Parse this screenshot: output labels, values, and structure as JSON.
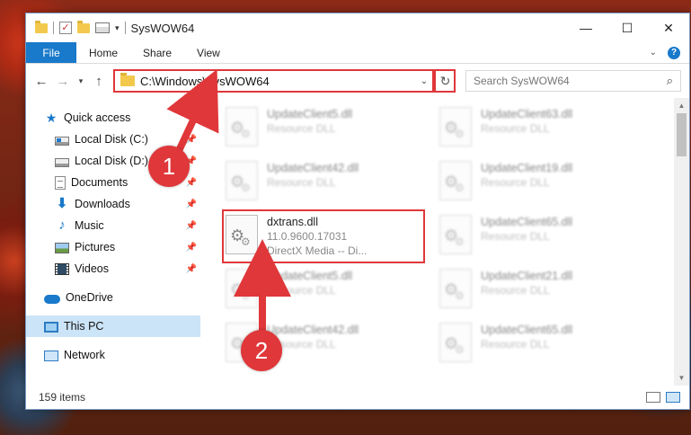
{
  "window": {
    "title": "SysWOW64",
    "minimize_label": "—",
    "maximize_label": "☐",
    "close_label": "✕"
  },
  "ribbon": {
    "tabs": [
      "File",
      "Home",
      "Share",
      "View"
    ],
    "help_label": "?"
  },
  "address": {
    "path": "C:\\Windows\\SysWOW64",
    "search_placeholder": "Search SysWOW64"
  },
  "nav": {
    "items": [
      {
        "label": "Quick access",
        "icon": "star-icon"
      },
      {
        "label": "Local Disk (C:)",
        "icon": "disk-icon"
      },
      {
        "label": "Local Disk (D:)",
        "icon": "disk-icon"
      },
      {
        "label": "Documents",
        "icon": "documents-icon"
      },
      {
        "label": "Downloads",
        "icon": "downloads-icon"
      },
      {
        "label": "Music",
        "icon": "music-icon"
      },
      {
        "label": "Pictures",
        "icon": "pictures-icon"
      },
      {
        "label": "Videos",
        "icon": "videos-icon"
      },
      {
        "label": "OneDrive",
        "icon": "onedrive-icon"
      },
      {
        "label": "This PC",
        "icon": "this-pc-icon"
      },
      {
        "label": "Network",
        "icon": "network-icon"
      }
    ]
  },
  "files": [
    {
      "name": "UpdateClient5.dll",
      "type": "Resource DLL"
    },
    {
      "name": "UpdateClient63.dll",
      "type": "Resource DLL"
    },
    {
      "name": "UpdateClient42.dll",
      "type": "Resource DLL"
    },
    {
      "name": "UpdateClient19.dll",
      "type": "Resource DLL"
    },
    {
      "name": "dxtrans.dll",
      "version": "11.0.9600.17031",
      "description": "DirectX Media -- Di..."
    },
    {
      "name": "UpdateClient65.dll",
      "type": "Resource DLL"
    },
    {
      "name": "UpdateClient5.dll",
      "type": "Resource DLL"
    },
    {
      "name": "UpdateClient21.dll",
      "type": "Resource DLL"
    },
    {
      "name": "UpdateClient42.dll",
      "type": "Resource DLL"
    },
    {
      "name": "UpdateClient65.dll",
      "type": "Resource DLL"
    }
  ],
  "status": {
    "item_count": "159 items"
  },
  "annotations": {
    "step1": "1",
    "step2": "2",
    "color": "#e0373a"
  }
}
